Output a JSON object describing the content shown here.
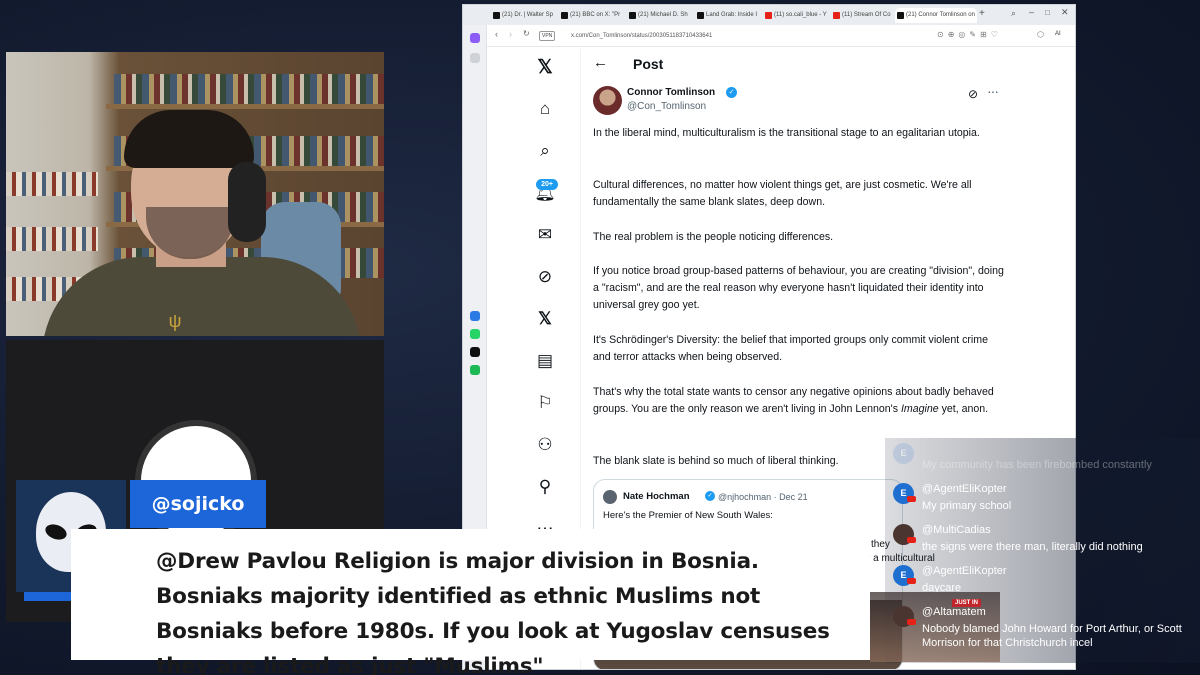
{
  "browser": {
    "tabs": [
      {
        "label": "(21) Dr. | Walter Sp",
        "icon": "x-icon"
      },
      {
        "label": "(21) BBC on X: \"Pr",
        "icon": "x-icon"
      },
      {
        "label": "(21) Michael D. Sh",
        "icon": "x-icon"
      },
      {
        "label": "Land Grab: Inside I",
        "icon": "page-icon"
      },
      {
        "label": "(11) so.cali_blue - Y",
        "icon": "youtube-icon"
      },
      {
        "label": "(11) Stream Of Co",
        "icon": "youtube-icon"
      },
      {
        "label": "(21) Connor Tomlinson on",
        "icon": "x-icon"
      }
    ],
    "vpn_label": "VPN",
    "url": "x.com/Con_Tomlinson/status/2003051183710433641",
    "ai_label": "AI"
  },
  "x_nav": {
    "items": [
      "x-logo-icon",
      "home-icon",
      "explore-icon",
      "notifications-icon",
      "messages-icon",
      "grok-icon",
      "premium-icon",
      "lists-icon",
      "bookmarks-icon",
      "communities-icon",
      "profile-icon",
      "more-icon"
    ],
    "notification_count": "20+"
  },
  "post": {
    "header_title": "Post",
    "author_name": "Connor Tomlinson",
    "author_handle": "@Con_Tomlinson",
    "paragraphs": {
      "p1": "In the liberal mind, multiculturalism is the transitional stage to an egalitarian utopia.",
      "p2": "Cultural differences, no matter how violent things get, are just cosmetic. We're all fundamentally the same blank slates, deep down.",
      "p3": "The real problem is the people noticing differences.",
      "p4": "If you notice broad group-based patterns of behaviour, you are creating \"division\", doing a \"racism\", and are the real reason why everyone hasn't liquidated their identity into universal grey goo yet.",
      "p5": "It's Schrödinger's Diversity: the belief that imported groups only commit violent crime and terror attacks when being observed.",
      "p6_before": "That's why the total state wants to censor any negative opinions about badly behaved groups. You are the only reason we aren't living in John Lennon's ",
      "p6_italic": "Imagine",
      "p6_after": " yet, anon.",
      "p7": "The blank slate is behind so much of liberal thinking."
    },
    "quote": {
      "name": "Nate Hochman",
      "handle": "@njhochman · Dec 21",
      "text": "Here's the Premier of New South Wales:"
    },
    "partial_text_1": "they",
    "partial_text_2": "r a multicultural"
  },
  "chat": {
    "messages": [
      {
        "initial": "E",
        "user": "",
        "text": "My community has been firebombed constantly",
        "faded": true
      },
      {
        "initial": "E",
        "user": "@AgentEliKopter",
        "text": "My primary school",
        "faded": false
      },
      {
        "initial": "",
        "user": "@MultiCadias",
        "text": "the signs were there man, literally did nothing",
        "faded": false
      },
      {
        "initial": "E",
        "user": "@AgentEliKopter",
        "text": "daycare",
        "faded": false
      },
      {
        "initial": "",
        "user": "@Altamatem",
        "text": "Nobody blamed John Howard for Port Arthur, or Scott Morrison for that Christchurch incel",
        "faded": false
      }
    ],
    "just_in_label": "JUST IN"
  },
  "overlay": {
    "handle": "@sojicko",
    "message": "@Drew Pavlou Religion is major division in Bosnia. Bosniaks majority identified as ethnic Muslims not Bosniaks before 1980s. If you look at Yugoslav censuses they are listed as just \"Muslims\"",
    "brand_color": "#1c66d9",
    "youtube_color": "#e62117"
  }
}
